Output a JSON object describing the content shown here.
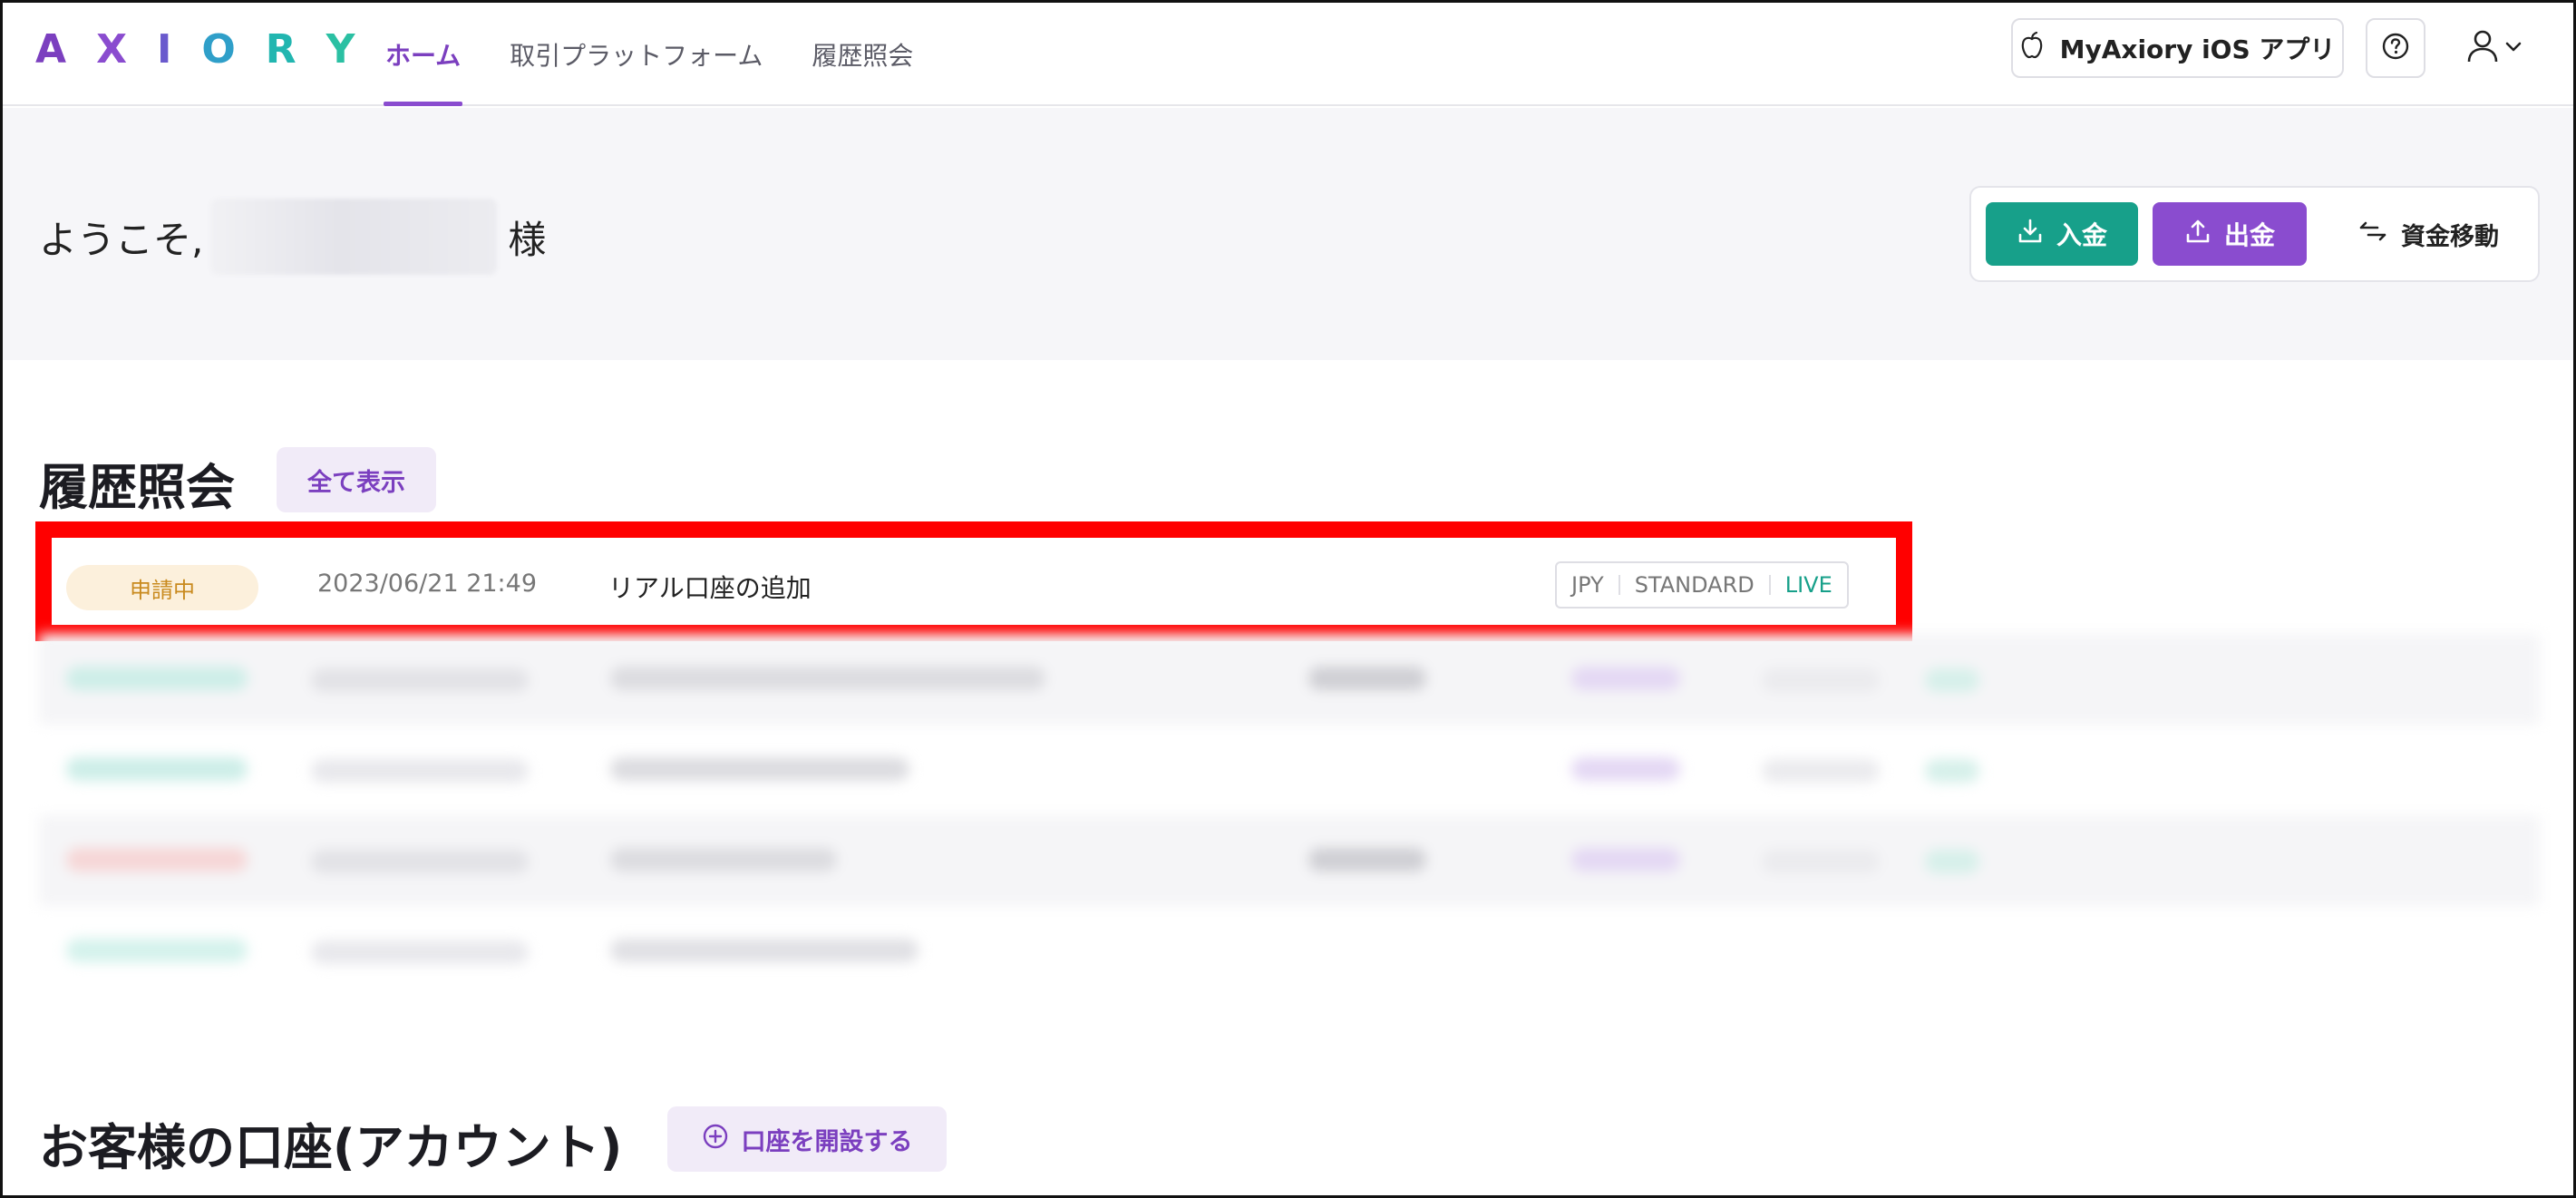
{
  "header": {
    "logo_letters": [
      "A",
      "X",
      "I",
      "O",
      "R",
      "Y"
    ],
    "logo_colors": [
      "#7b3fbf",
      "#7b3fbf",
      "#6a5acd",
      "#2f9fc9",
      "#22b6b0",
      "#2bc0a3"
    ],
    "nav": [
      {
        "label": "ホーム",
        "active": true
      },
      {
        "label": "取引プラットフォーム",
        "active": false
      },
      {
        "label": "履歴照会",
        "active": false
      }
    ],
    "ios_app_label": "MyAxiory iOS アプリ",
    "icons": {
      "apple": "apple-icon",
      "help": "help-icon",
      "user": "user-icon",
      "chevron": "chevron-down-icon"
    }
  },
  "welcome": {
    "greeting": "ようこそ,",
    "suffix": "様",
    "deposit_label": "入金",
    "withdraw_label": "出金",
    "transfer_label": "資金移動"
  },
  "history": {
    "title": "履歴照会",
    "show_all_label": "全て表示",
    "highlighted_row": {
      "status": "申請中",
      "datetime": "2023/06/21 21:49",
      "description": "リアル口座の追加",
      "tags": [
        "JPY",
        "STANDARD",
        "LIVE"
      ]
    }
  },
  "accounts": {
    "title": "お客様の口座(アカウント)",
    "open_account_label": "口座を開設する"
  },
  "colors": {
    "accent_purple": "#8a4ccf",
    "accent_green": "#17a08a",
    "highlight_red": "#ff0000",
    "pending_orange": "#c98a1e"
  }
}
